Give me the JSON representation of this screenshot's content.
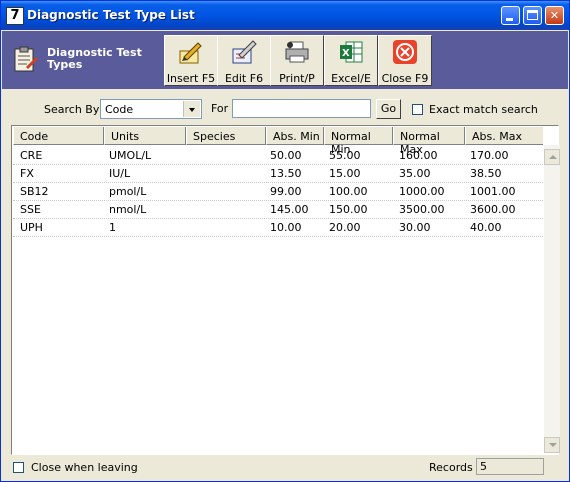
{
  "window": {
    "app_icon_glyph": "7",
    "title": "Diagnostic Test Type List",
    "controls": [
      "minimize-icon",
      "maximize-icon",
      "close-icon"
    ]
  },
  "toolbar": {
    "title": "Diagnostic Test Types",
    "buttons": [
      {
        "label": "Insert F5",
        "icon": "insert-pencil-icon"
      },
      {
        "label": "Edit F6",
        "icon": "edit-pencil-icon"
      },
      {
        "label": "Print/P",
        "icon": "printer-icon"
      },
      {
        "label": "Excel/E",
        "icon": "excel-icon"
      },
      {
        "label": "Close F9",
        "icon": "close-circle-icon"
      }
    ],
    "close_color": "#e8432b"
  },
  "search": {
    "search_by_label": "Search By",
    "search_by_value": "Code",
    "for_label": "For",
    "for_value": "",
    "go_label": "Go",
    "exact_match_label": "Exact match search",
    "exact_match_checked": false
  },
  "grid": {
    "columns": [
      "Code",
      "Units",
      "Species",
      "Abs. Min",
      "Normal Min",
      "Normal Max",
      "Abs. Max"
    ],
    "rows": [
      [
        "CRE",
        "UMOL/L",
        "",
        "50.00",
        "55.00",
        "160.00",
        "170.00"
      ],
      [
        "FX",
        "IU/L",
        "",
        "13.50",
        "15.00",
        "35.00",
        "38.50"
      ],
      [
        "SB12",
        "pmol/L",
        "",
        "99.00",
        "100.00",
        "1000.00",
        "1001.00"
      ],
      [
        "SSE",
        "nmol/L",
        "",
        "145.00",
        "150.00",
        "3500.00",
        "3600.00"
      ],
      [
        "UPH",
        "1",
        "",
        "10.00",
        "20.00",
        "30.00",
        "40.00"
      ]
    ]
  },
  "footer": {
    "close_when_leaving_label": "Close when leaving",
    "close_when_leaving_checked": false,
    "records_label": "Records",
    "records_value": "5"
  }
}
